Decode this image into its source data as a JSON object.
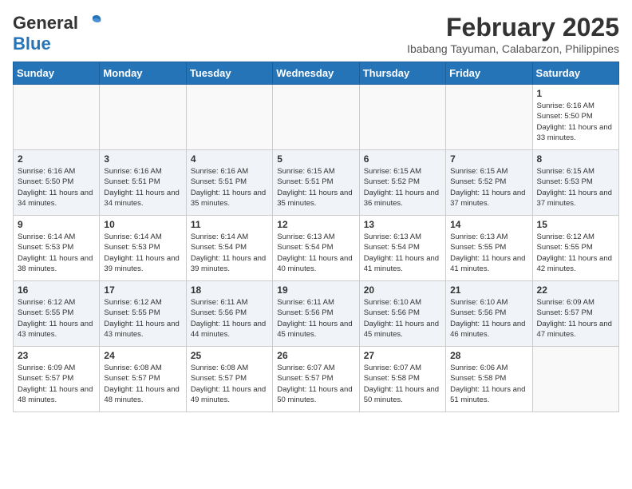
{
  "header": {
    "logo_general": "General",
    "logo_blue": "Blue",
    "month_title": "February 2025",
    "location": "Ibabang Tayuman, Calabarzon, Philippines"
  },
  "days_of_week": [
    "Sunday",
    "Monday",
    "Tuesday",
    "Wednesday",
    "Thursday",
    "Friday",
    "Saturday"
  ],
  "weeks": [
    [
      {
        "day": "",
        "info": ""
      },
      {
        "day": "",
        "info": ""
      },
      {
        "day": "",
        "info": ""
      },
      {
        "day": "",
        "info": ""
      },
      {
        "day": "",
        "info": ""
      },
      {
        "day": "",
        "info": ""
      },
      {
        "day": "1",
        "info": "Sunrise: 6:16 AM\nSunset: 5:50 PM\nDaylight: 11 hours and 33 minutes."
      }
    ],
    [
      {
        "day": "2",
        "info": "Sunrise: 6:16 AM\nSunset: 5:50 PM\nDaylight: 11 hours and 34 minutes."
      },
      {
        "day": "3",
        "info": "Sunrise: 6:16 AM\nSunset: 5:51 PM\nDaylight: 11 hours and 34 minutes."
      },
      {
        "day": "4",
        "info": "Sunrise: 6:16 AM\nSunset: 5:51 PM\nDaylight: 11 hours and 35 minutes."
      },
      {
        "day": "5",
        "info": "Sunrise: 6:15 AM\nSunset: 5:51 PM\nDaylight: 11 hours and 35 minutes."
      },
      {
        "day": "6",
        "info": "Sunrise: 6:15 AM\nSunset: 5:52 PM\nDaylight: 11 hours and 36 minutes."
      },
      {
        "day": "7",
        "info": "Sunrise: 6:15 AM\nSunset: 5:52 PM\nDaylight: 11 hours and 37 minutes."
      },
      {
        "day": "8",
        "info": "Sunrise: 6:15 AM\nSunset: 5:53 PM\nDaylight: 11 hours and 37 minutes."
      }
    ],
    [
      {
        "day": "9",
        "info": "Sunrise: 6:14 AM\nSunset: 5:53 PM\nDaylight: 11 hours and 38 minutes."
      },
      {
        "day": "10",
        "info": "Sunrise: 6:14 AM\nSunset: 5:53 PM\nDaylight: 11 hours and 39 minutes."
      },
      {
        "day": "11",
        "info": "Sunrise: 6:14 AM\nSunset: 5:54 PM\nDaylight: 11 hours and 39 minutes."
      },
      {
        "day": "12",
        "info": "Sunrise: 6:13 AM\nSunset: 5:54 PM\nDaylight: 11 hours and 40 minutes."
      },
      {
        "day": "13",
        "info": "Sunrise: 6:13 AM\nSunset: 5:54 PM\nDaylight: 11 hours and 41 minutes."
      },
      {
        "day": "14",
        "info": "Sunrise: 6:13 AM\nSunset: 5:55 PM\nDaylight: 11 hours and 41 minutes."
      },
      {
        "day": "15",
        "info": "Sunrise: 6:12 AM\nSunset: 5:55 PM\nDaylight: 11 hours and 42 minutes."
      }
    ],
    [
      {
        "day": "16",
        "info": "Sunrise: 6:12 AM\nSunset: 5:55 PM\nDaylight: 11 hours and 43 minutes."
      },
      {
        "day": "17",
        "info": "Sunrise: 6:12 AM\nSunset: 5:55 PM\nDaylight: 11 hours and 43 minutes."
      },
      {
        "day": "18",
        "info": "Sunrise: 6:11 AM\nSunset: 5:56 PM\nDaylight: 11 hours and 44 minutes."
      },
      {
        "day": "19",
        "info": "Sunrise: 6:11 AM\nSunset: 5:56 PM\nDaylight: 11 hours and 45 minutes."
      },
      {
        "day": "20",
        "info": "Sunrise: 6:10 AM\nSunset: 5:56 PM\nDaylight: 11 hours and 45 minutes."
      },
      {
        "day": "21",
        "info": "Sunrise: 6:10 AM\nSunset: 5:56 PM\nDaylight: 11 hours and 46 minutes."
      },
      {
        "day": "22",
        "info": "Sunrise: 6:09 AM\nSunset: 5:57 PM\nDaylight: 11 hours and 47 minutes."
      }
    ],
    [
      {
        "day": "23",
        "info": "Sunrise: 6:09 AM\nSunset: 5:57 PM\nDaylight: 11 hours and 48 minutes."
      },
      {
        "day": "24",
        "info": "Sunrise: 6:08 AM\nSunset: 5:57 PM\nDaylight: 11 hours and 48 minutes."
      },
      {
        "day": "25",
        "info": "Sunrise: 6:08 AM\nSunset: 5:57 PM\nDaylight: 11 hours and 49 minutes."
      },
      {
        "day": "26",
        "info": "Sunrise: 6:07 AM\nSunset: 5:57 PM\nDaylight: 11 hours and 50 minutes."
      },
      {
        "day": "27",
        "info": "Sunrise: 6:07 AM\nSunset: 5:58 PM\nDaylight: 11 hours and 50 minutes."
      },
      {
        "day": "28",
        "info": "Sunrise: 6:06 AM\nSunset: 5:58 PM\nDaylight: 11 hours and 51 minutes."
      },
      {
        "day": "",
        "info": ""
      }
    ]
  ]
}
